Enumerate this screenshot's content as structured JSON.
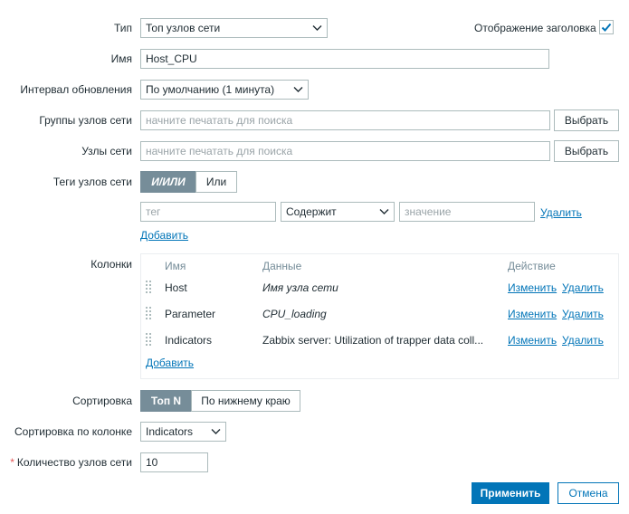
{
  "form": {
    "type": {
      "label": "Тип",
      "value": "Топ узлов сети"
    },
    "show_header": {
      "label": "Отображение заголовка",
      "checked": true
    },
    "name": {
      "label": "Имя",
      "value": "Host_CPU"
    },
    "refresh": {
      "label": "Интервал обновления",
      "value": "По умолчанию (1 минута)"
    },
    "host_groups": {
      "label": "Группы узлов сети",
      "placeholder": "начните печатать для поиска",
      "button": "Выбрать"
    },
    "hosts": {
      "label": "Узлы сети",
      "placeholder": "начните печатать для поиска",
      "button": "Выбрать"
    },
    "host_tags": {
      "label": "Теги узлов сети",
      "options": [
        "И/ИЛИ",
        "Или"
      ],
      "tag_placeholder": "тег",
      "operator": "Содержит",
      "value_placeholder": "значение",
      "remove": "Удалить",
      "add": "Добавить"
    },
    "columns": {
      "label": "Колонки",
      "headers": {
        "name": "Имя",
        "data": "Данные",
        "action": "Действие"
      },
      "rows": [
        {
          "name": "Host",
          "data": "Имя узла сети",
          "edit": "Изменить",
          "remove": "Удалить"
        },
        {
          "name": "Parameter",
          "data": "CPU_loading",
          "edit": "Изменить",
          "remove": "Удалить"
        },
        {
          "name": "Indicators",
          "data": "Zabbix server: Utilization of trapper data coll...",
          "edit": "Изменить",
          "remove": "Удалить"
        }
      ],
      "add": "Добавить"
    },
    "order": {
      "label": "Сортировка",
      "options": [
        "Топ N",
        "По нижнему краю"
      ]
    },
    "order_column": {
      "label": "Сортировка по колонке",
      "value": "Indicators"
    },
    "host_count": {
      "label": "Количество узлов сети",
      "required_mark": "*",
      "value": "10"
    },
    "apply": "Применить",
    "cancel": "Отмена"
  },
  "colors": {
    "accent": "#0275b8",
    "segment_active": "#768d99",
    "required": "#e45959"
  }
}
